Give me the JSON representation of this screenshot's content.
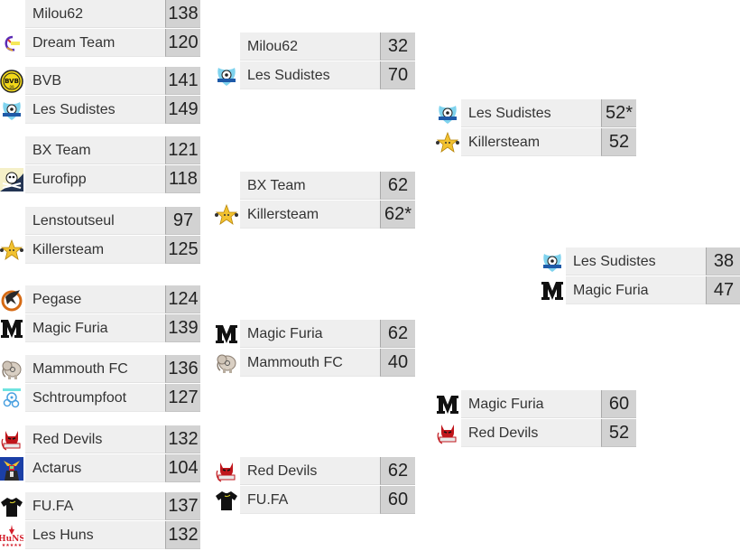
{
  "bracket": {
    "rounds": [
      {
        "matches": [
          {
            "teams": [
              {
                "name": "Milou62",
                "score": "138",
                "logo": "none"
              },
              {
                "name": "Dream Team",
                "score": "120",
                "logo": "dream-team-logo"
              }
            ]
          },
          {
            "teams": [
              {
                "name": "BVB",
                "score": "141",
                "logo": "bvb-logo"
              },
              {
                "name": "Les Sudistes",
                "score": "149",
                "logo": "les-sudistes-logo"
              }
            ]
          },
          {
            "teams": [
              {
                "name": "BX Team",
                "score": "121",
                "logo": "none"
              },
              {
                "name": "Eurofipp",
                "score": "118",
                "logo": "pirate-skull-logo"
              }
            ]
          },
          {
            "teams": [
              {
                "name": "Lenstoutseul",
                "score": "97",
                "logo": "none"
              },
              {
                "name": "Killersteam",
                "score": "125",
                "logo": "star-logo"
              }
            ]
          },
          {
            "teams": [
              {
                "name": "Pegase",
                "score": "124",
                "logo": "pegasus-logo"
              },
              {
                "name": "Magic Furia",
                "score": "139",
                "logo": "m-letter-logo"
              }
            ]
          },
          {
            "teams": [
              {
                "name": "Mammouth FC",
                "score": "136",
                "logo": "mammoth-logo"
              },
              {
                "name": "Schtroumpfoot",
                "score": "127",
                "logo": "smurf-logo"
              }
            ]
          },
          {
            "teams": [
              {
                "name": "Red Devils",
                "score": "132",
                "logo": "red-devil-logo"
              },
              {
                "name": "Actarus",
                "score": "104",
                "logo": "robot-logo"
              }
            ]
          },
          {
            "teams": [
              {
                "name": "FU.FA",
                "score": "137",
                "logo": "black-shirt-logo"
              },
              {
                "name": "Les Huns",
                "score": "132",
                "logo": "huns-logo"
              }
            ]
          }
        ]
      },
      {
        "matches": [
          {
            "teams": [
              {
                "name": "Milou62",
                "score": "32",
                "logo": "none"
              },
              {
                "name": "Les Sudistes",
                "score": "70",
                "logo": "les-sudistes-logo"
              }
            ]
          },
          {
            "teams": [
              {
                "name": "BX Team",
                "score": "62",
                "logo": "none"
              },
              {
                "name": "Killersteam",
                "score": "62*",
                "logo": "star-logo"
              }
            ]
          },
          {
            "teams": [
              {
                "name": "Magic Furia",
                "score": "62",
                "logo": "m-letter-logo"
              },
              {
                "name": "Mammouth FC",
                "score": "40",
                "logo": "mammoth-logo"
              }
            ]
          },
          {
            "teams": [
              {
                "name": "Red Devils",
                "score": "62",
                "logo": "red-devil-logo"
              },
              {
                "name": "FU.FA",
                "score": "60",
                "logo": "black-shirt-logo"
              }
            ]
          }
        ]
      },
      {
        "matches": [
          {
            "teams": [
              {
                "name": "Les Sudistes",
                "score": "52*",
                "logo": "les-sudistes-logo"
              },
              {
                "name": "Killersteam",
                "score": "52",
                "logo": "star-logo"
              }
            ]
          },
          {
            "teams": [
              {
                "name": "Magic Furia",
                "score": "60",
                "logo": "m-letter-logo"
              },
              {
                "name": "Red Devils",
                "score": "52",
                "logo": "red-devil-logo"
              }
            ]
          }
        ]
      },
      {
        "matches": [
          {
            "teams": [
              {
                "name": "Les Sudistes",
                "score": "38",
                "logo": "les-sudistes-logo"
              },
              {
                "name": "Magic Furia",
                "score": "47",
                "logo": "m-letter-logo"
              }
            ]
          }
        ]
      }
    ]
  }
}
